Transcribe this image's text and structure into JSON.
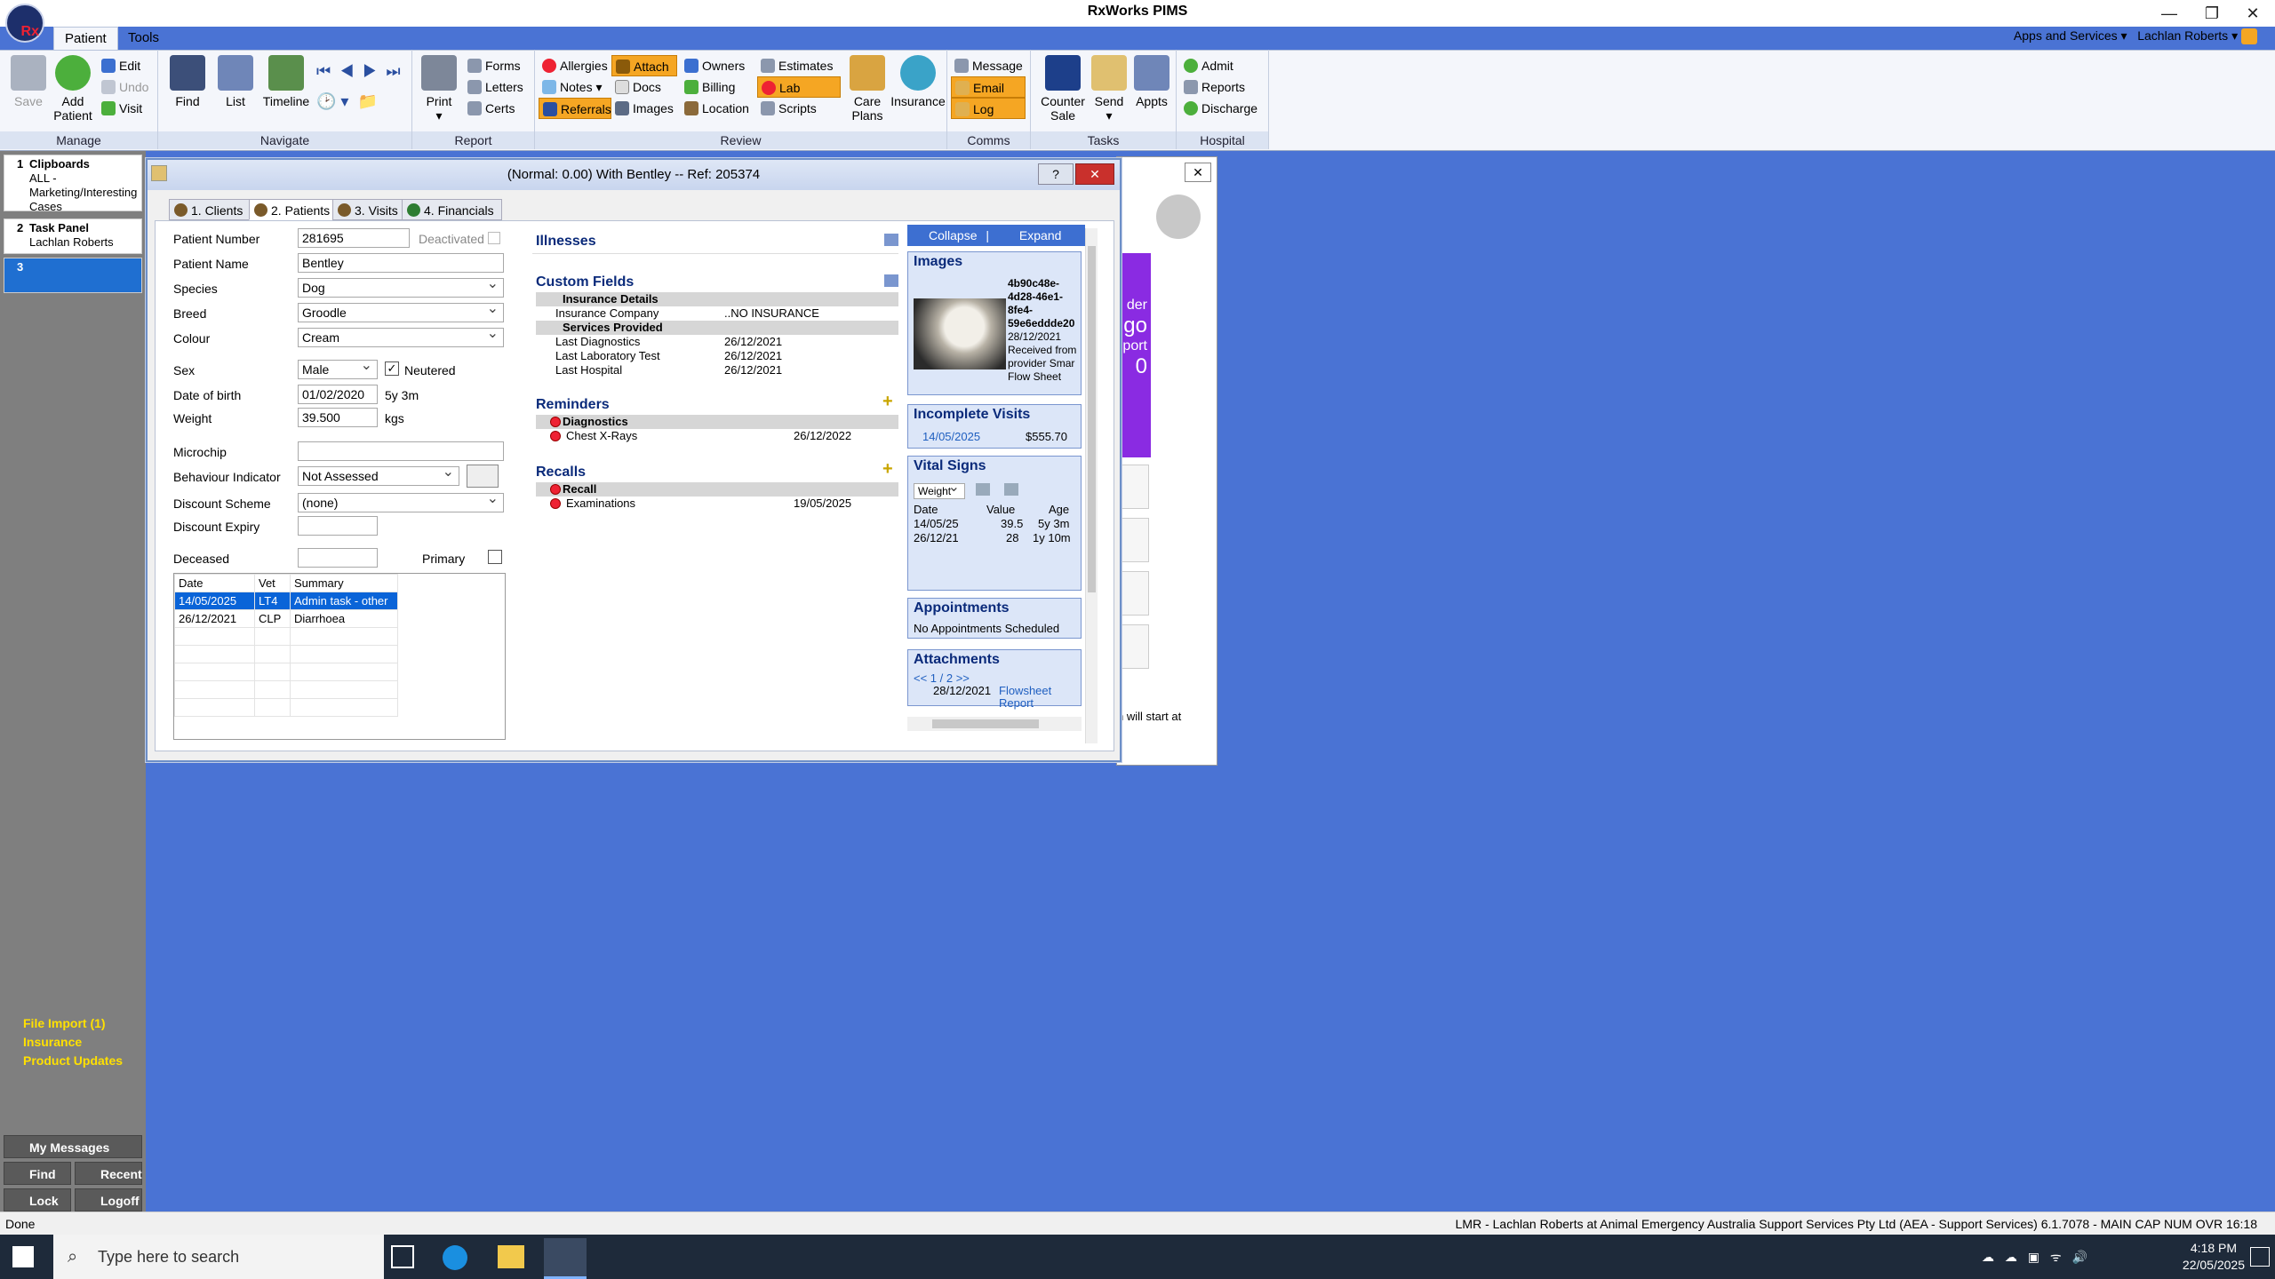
{
  "window": {
    "title": "RxWorks PIMS",
    "logo": "Rx"
  },
  "menu_tabs": [
    "Patient",
    "Tools"
  ],
  "top_right": {
    "apps": "Apps and Services",
    "user": "Lachlan Roberts"
  },
  "ribbon": {
    "manage": {
      "label": "Manage",
      "save": "Save",
      "add_patient": "Add Patient",
      "edit": "Edit",
      "undo": "Undo",
      "visit": "Visit"
    },
    "navigate": {
      "label": "Navigate",
      "find": "Find",
      "list": "List",
      "timeline": "Timeline"
    },
    "report": {
      "label": "Report",
      "print": "Print",
      "forms": "Forms",
      "letters": "Letters",
      "certs": "Certs"
    },
    "review": {
      "label": "Review",
      "allergies": "Allergies",
      "attach": "Attach",
      "owners": "Owners",
      "estimates": "Estimates",
      "notes": "Notes",
      "docs": "Docs",
      "billing": "Billing",
      "lab": "Lab",
      "referrals": "Referrals",
      "images": "Images",
      "location": "Location",
      "scripts": "Scripts",
      "care_plans": "Care Plans",
      "insurance": "Insurance"
    },
    "comms": {
      "label": "Comms",
      "message": "Message",
      "email": "Email",
      "log": "Log"
    },
    "tasks": {
      "label": "Tasks",
      "counter_sale": "Counter Sale",
      "send": "Send",
      "appts": "Appts"
    },
    "hospital": {
      "label": "Hospital",
      "admit": "Admit",
      "reports": "Reports",
      "discharge": "Discharge"
    }
  },
  "left_panel": {
    "clipboards": {
      "num": "1",
      "title": "Clipboards",
      "sub": "ALL - Marketing/Interesting Cases"
    },
    "task_panel": {
      "num": "2",
      "title": "Task Panel",
      "sub": "Lachlan Roberts"
    },
    "item3": {
      "num": "3"
    },
    "links": [
      "File Import (1)",
      "Insurance",
      "Product Updates"
    ],
    "my_messages": "My Messages",
    "buttons": {
      "find": "Find",
      "recent": "Recent",
      "lock": "Lock",
      "logoff": "Logoff"
    }
  },
  "dialog": {
    "title": "(Normal: 0.00) With Bentley -- Ref: 205374",
    "help": "?",
    "tabs": [
      "1. Clients",
      "2. Patients",
      "3. Visits",
      "4. Financials"
    ],
    "fields": {
      "patient_number": {
        "label": "Patient Number",
        "value": "281695"
      },
      "deactivated": "Deactivated",
      "patient_name": {
        "label": "Patient Name",
        "value": "Bentley"
      },
      "species": {
        "label": "Species",
        "value": "Dog"
      },
      "breed": {
        "label": "Breed",
        "value": "Groodle"
      },
      "colour": {
        "label": "Colour",
        "value": "Cream"
      },
      "sex": {
        "label": "Sex",
        "value": "Male"
      },
      "neutered": "Neutered",
      "dob": {
        "label": "Date of birth",
        "value": "01/02/2020",
        "age": "5y 3m"
      },
      "weight": {
        "label": "Weight",
        "value": "39.500",
        "unit": "kgs"
      },
      "microchip": {
        "label": "Microchip",
        "value": ""
      },
      "behaviour": {
        "label": "Behaviour Indicator",
        "value": "Not Assessed"
      },
      "discount_scheme": {
        "label": "Discount Scheme",
        "value": "(none)"
      },
      "discount_expiry": {
        "label": "Discount Expiry",
        "value": ""
      },
      "deceased": {
        "label": "Deceased",
        "value": ""
      },
      "primary": "Primary"
    },
    "history": {
      "headers": [
        "Date",
        "Vet",
        "Summary"
      ],
      "rows": [
        {
          "date": "14/05/2025",
          "vet": "LT4",
          "summary": "Admin task - other"
        },
        {
          "date": "26/12/2021",
          "vet": "CLP",
          "summary": "Diarrhoea"
        }
      ]
    },
    "illnesses": {
      "title": "Illnesses"
    },
    "custom_fields": {
      "title": "Custom Fields",
      "groups": [
        {
          "name": "Insurance Details",
          "rows": [
            {
              "k": "Insurance Company",
              "v": "..NO INSURANCE"
            }
          ]
        },
        {
          "name": "Services Provided",
          "rows": [
            {
              "k": "Last Diagnostics",
              "v": "26/12/2021"
            },
            {
              "k": "Last Laboratory Test",
              "v": "26/12/2021"
            },
            {
              "k": "Last Hospital",
              "v": "26/12/2021"
            }
          ]
        }
      ]
    },
    "reminders": {
      "title": "Reminders",
      "group": "Diagnostics",
      "item": "Chest X-Rays",
      "date": "26/12/2022"
    },
    "recalls": {
      "title": "Recalls",
      "group": "Recall",
      "item": "Examinations",
      "date": "19/05/2025"
    },
    "side": {
      "collapse": "Collapse",
      "expand": "Expand",
      "images": {
        "title": "Images",
        "caption": [
          "4b90c48e-",
          "4d28-46e1-",
          "8fe4-",
          "59e6eddde20",
          "28/12/2021",
          "Received from",
          "provider Smar",
          "Flow Sheet"
        ]
      },
      "incomplete": {
        "title": "Incomplete Visits",
        "date": "14/05/2025",
        "amount": "$555.70"
      },
      "vitals": {
        "title": "Vital Signs",
        "select": "Weight",
        "headers": [
          "Date",
          "Value",
          "Age"
        ],
        "rows": [
          [
            "14/05/25",
            "39.5",
            "5y 3m"
          ],
          [
            "26/12/21",
            "28",
            "1y 10m"
          ]
        ]
      },
      "appointments": {
        "title": "Appointments",
        "text": "No Appointments Scheduled"
      },
      "attachments": {
        "title": "Attachments",
        "pager": "<< 1 / 2 >>",
        "date": "28/12/2021",
        "link1": "Flowsheet",
        "link2": "Report"
      }
    }
  },
  "bg_window": {
    "frag1": "der",
    "frag2": "go",
    "frag3": "port",
    "frag4": "0",
    "frag5": "n will start at"
  },
  "status": {
    "left": "Done",
    "right": "LMR - Lachlan Roberts at Animal Emergency Australia Support Services Pty Ltd (AEA - Support Services) 6.1.7078 - MAIN  CAP  NUM  OVR  16:18"
  },
  "taskbar": {
    "search": "Type here to search",
    "time": "4:18 PM",
    "date": "22/05/2025"
  },
  "colors": {
    "accent": "#f5a623",
    "desktop": "#4a73d4",
    "section": "#0a2a7a"
  }
}
